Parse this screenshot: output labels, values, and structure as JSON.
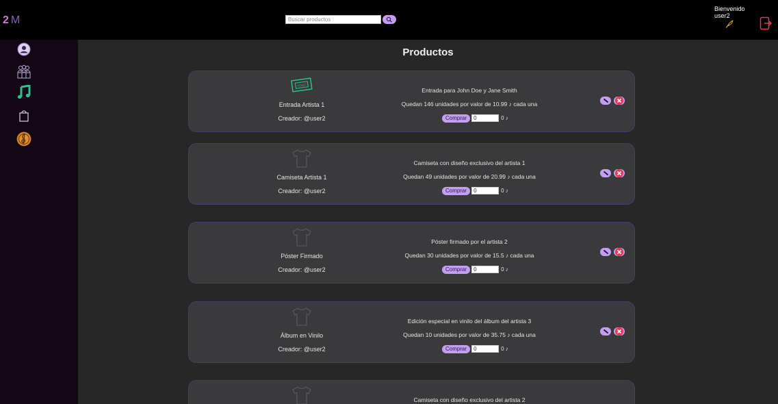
{
  "header": {
    "logo_two": "2",
    "logo_m": "M",
    "search_placeholder": "Buscar productos",
    "welcome_label": "Bienvenido",
    "username": "user2"
  },
  "sidebar": {
    "items": [
      {
        "icon": "user-icon"
      },
      {
        "icon": "group-icon"
      },
      {
        "icon": "music-note-icon"
      },
      {
        "icon": "shopping-bag-icon"
      },
      {
        "icon": "treble-clef-icon"
      }
    ]
  },
  "main": {
    "title": "Productos",
    "buy_label": "Comprar",
    "total_value": "0 ♪",
    "products": [
      {
        "name": "Entrada Artista 1",
        "creator": "Creador: @user2",
        "description": "Entrada para John Doe y Jane Smith",
        "stock": "Quedan 146 unidades por valor de 10.99 ♪ cada una",
        "quantity": "0",
        "image": "ticket-icon"
      },
      {
        "name": "Camiseta Artista 1",
        "creator": "Creador: @user2",
        "description": "Camiseta con diseño exclusivo del artista 1",
        "stock": "Quedan 49 unidades por valor de 20.99 ♪ cada una",
        "quantity": "0",
        "image": "tshirt-icon"
      },
      {
        "name": "Póster Firmado",
        "creator": "Creador: @user2",
        "description": "Póster firmado por el artista 2",
        "stock": "Quedan 30 unidades por valor de 15.5 ♪ cada una",
        "quantity": "0",
        "image": "tshirt-icon"
      },
      {
        "name": "Álbum en Vinilo",
        "creator": "Creador: @user2",
        "description": "Edición especial en vinilo del álbum del artista 3",
        "stock": "Quedan 10 unidades por valor de 35.75 ♪ cada una",
        "quantity": "0",
        "image": "tshirt-icon"
      },
      {
        "name": "",
        "creator": "",
        "description": "Camiseta con diseño exclusivo del artista 2",
        "stock": "",
        "quantity": "0",
        "image": "tshirt-icon"
      }
    ]
  },
  "colors": {
    "accent": "#c49ff0",
    "header_bg": "#000000",
    "sidebar_bg": "#130716",
    "card_bg": "#3a393b"
  }
}
